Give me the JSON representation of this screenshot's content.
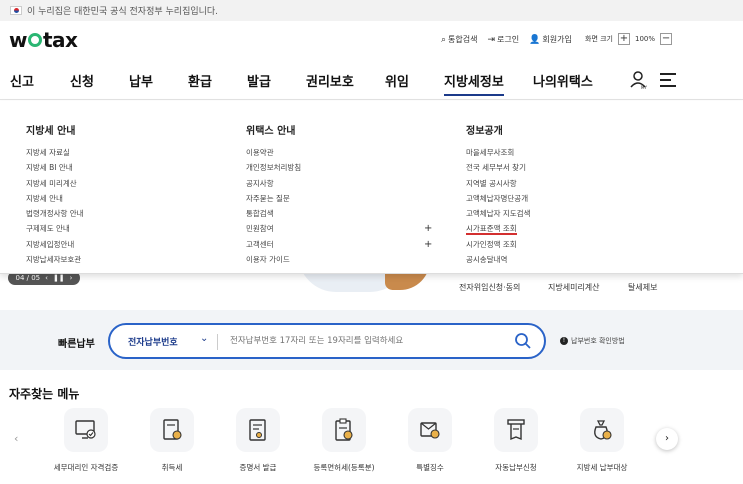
{
  "gov_banner": {
    "text": "이 누리집은 대한민국 공식 전자정부 누리집입니다."
  },
  "logo": {
    "pre": "w",
    "post": "tax"
  },
  "util": {
    "search": "통합검색",
    "login": "로그인",
    "signup": "회원가입",
    "zoom_label": "화면 크기",
    "zoom_plus": "+",
    "zoom_value": "100%",
    "zoom_minus": "−"
  },
  "nav": {
    "items": [
      "신고",
      "신청",
      "납부",
      "환급",
      "발급",
      "권리보호",
      "위임",
      "지방세정보",
      "나의위택스"
    ],
    "active": "지방세정보",
    "user_badge": "MY"
  },
  "mega": {
    "col1": {
      "title": "지방세 안내",
      "items": [
        "지방세 자료실",
        "지방세 BI 안내",
        "지방세 미리계산",
        "지방세 안내",
        "법령개정사항 안내",
        "구제제도 안내",
        "지방세입정안내",
        "지방납세자보호관"
      ]
    },
    "col2": {
      "title": "위택스 안내",
      "items": [
        "이용약관",
        "개인정보처리방침",
        "공지사항",
        "자주묻는 질문",
        "통합검색",
        "민원참여",
        "고객센터",
        "이용자 가이드"
      ],
      "expandable": [
        "민원참여",
        "고객센터"
      ]
    },
    "col3": {
      "title": "정보공개",
      "items": [
        "마을세무사조회",
        "전국 세무부서 찾기",
        "지역별 공시사항",
        "고액체납자명단공개",
        "고액체납자 지도검색",
        "시가표준액 조회",
        "시가인정액 조회",
        "공시송달내역"
      ],
      "highlighted": "시가표준액 조회"
    }
  },
  "hero": {
    "pager": "04 / 05",
    "links": [
      "전자위임신청·동의",
      "지방세미리계산",
      "탈세제보"
    ]
  },
  "quick_pay": {
    "label": "빠른납부",
    "select": "전자납부번호",
    "placeholder": "전자납부번호 17자리 또는 19자리를 입력하세요",
    "help": "납부번호 확인방법"
  },
  "frequent": {
    "title": "자주찾는 메뉴",
    "items": [
      "세무대리인 자격검증",
      "취득세",
      "증명서 발급",
      "등록면허세(등록분)",
      "특별징수",
      "자동납부신청",
      "지방세 납부대상"
    ]
  },
  "colors": {
    "accent": "#2a63c8",
    "nav_active": "#1b3a8a",
    "logo_green": "#2bb673",
    "highlight_underline": "#d32f2f"
  }
}
